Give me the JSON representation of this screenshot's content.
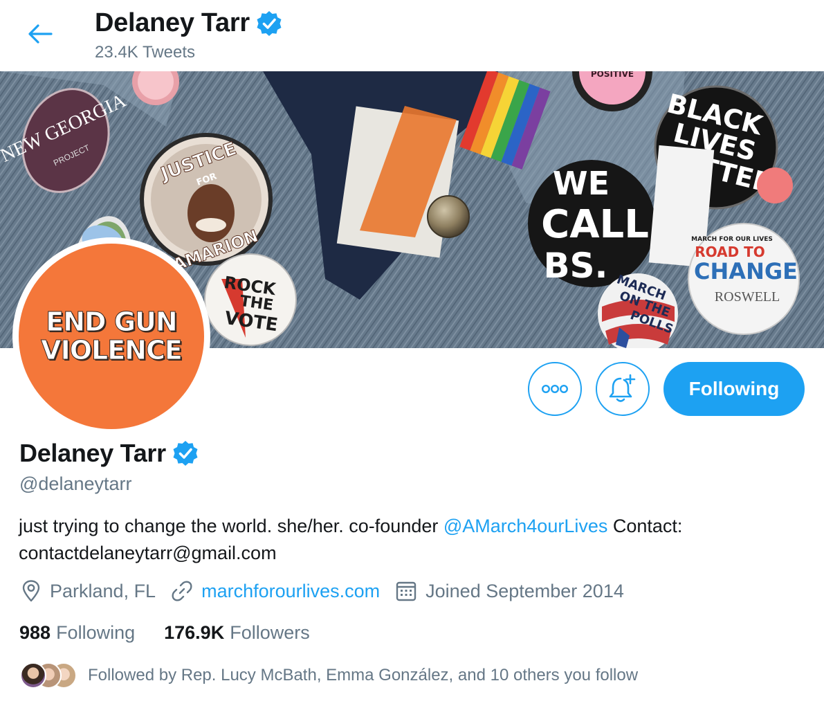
{
  "header": {
    "name": "Delaney Tarr",
    "tweet_count": "23.4K Tweets"
  },
  "banner": {
    "pins": [
      "NEW GEORGIA",
      "PROJECT",
      "JUSTICE",
      "FOR",
      "JAMARION",
      "ROCK",
      "THE",
      "VOTE",
      "BLACK",
      "LIVES",
      "MATTER",
      "WE",
      "CALL",
      "BS.",
      "MARCH",
      "ON THE",
      "POLLS",
      "MARCH FOR OUR LIVES",
      "ROAD TO",
      "CHANGE",
      "ROSWELL",
      "POSITIVE"
    ]
  },
  "avatar": {
    "line1": "END GUN",
    "line2": "VIOLENCE"
  },
  "actions": {
    "follow_label": "Following"
  },
  "profile": {
    "name": "Delaney Tarr",
    "handle": "@delaneytarr",
    "bio_prefix": "just trying to change the world. she/her. co-founder ",
    "bio_mention": "@AMarch4ourLives",
    "bio_suffix": " Contact: contactdelaneytarr@gmail.com",
    "location": "Parkland, FL",
    "website": "marchforourlives.com",
    "joined": "Joined September 2014",
    "following_count": "988",
    "following_label": "Following",
    "followers_count": "176.9K",
    "followers_label": "Followers",
    "followed_by": "Followed by Rep. Lucy McBath, Emma González, and 10 others you follow"
  },
  "colors": {
    "accent": "#1da1f2",
    "secondary_text": "#657786",
    "primary_text": "#14171a",
    "avatar_bg": "#f4773a"
  },
  "icons": [
    "back-arrow-icon",
    "verified-badge-icon",
    "more-icon",
    "notification-bell-plus-icon",
    "location-pin-icon",
    "link-icon",
    "calendar-icon"
  ]
}
